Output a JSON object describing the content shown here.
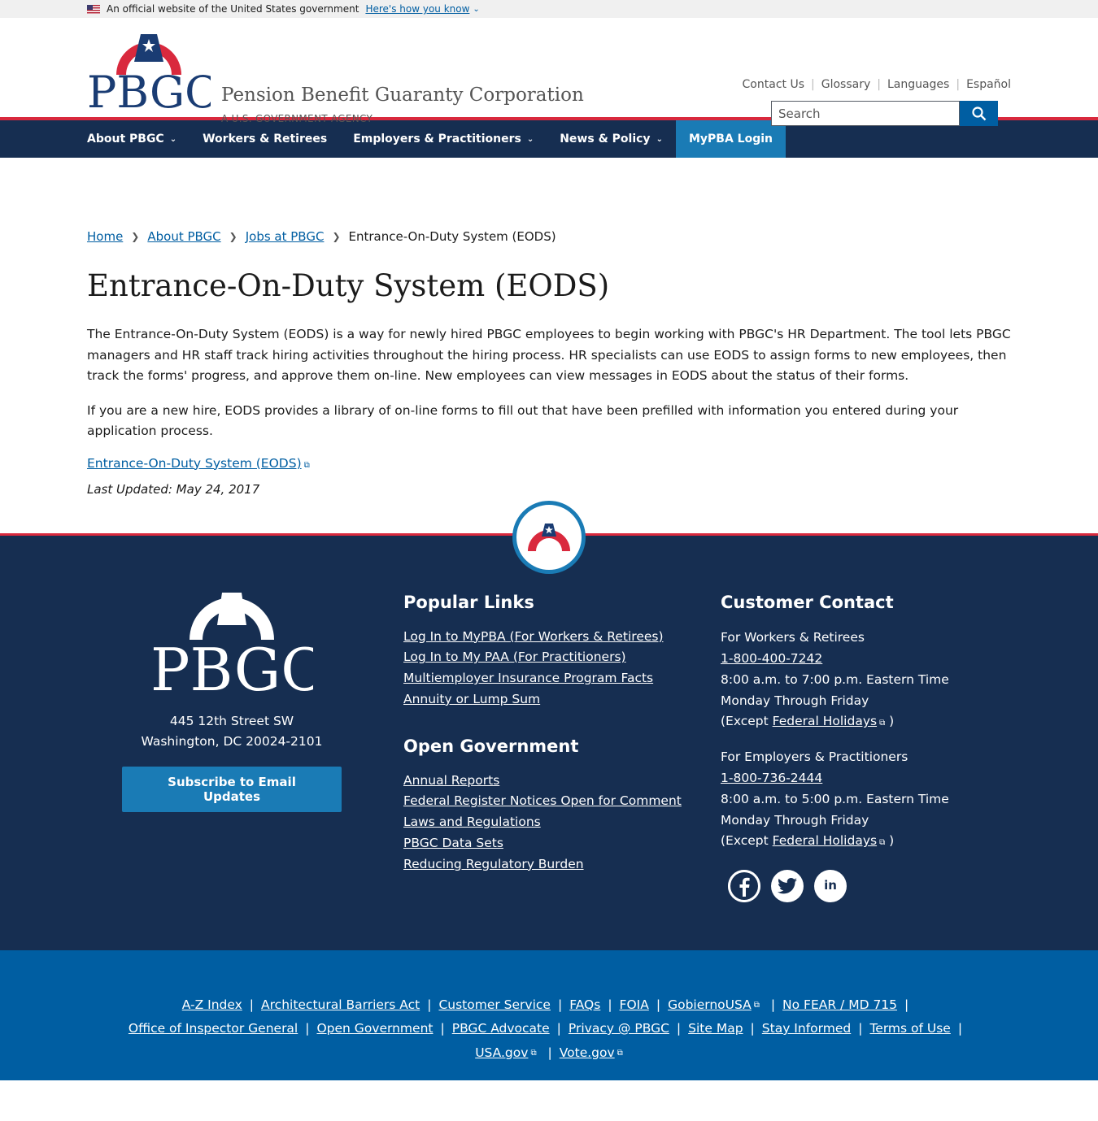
{
  "gov_banner": {
    "text": "An official website of the United States government",
    "link": "Here's how you know"
  },
  "header": {
    "logo_text": "PBGC",
    "agency_name": "Pension Benefit Guaranty Corporation",
    "agency_sub": "A U.S. GOVERNMENT AGENCY",
    "util_links": [
      "Contact Us",
      "Glossary",
      "Languages",
      "Español"
    ],
    "search_placeholder": "Search"
  },
  "nav": {
    "items": [
      "About PBGC",
      "Workers & Retirees",
      "Employers & Practitioners",
      "News & Policy"
    ],
    "login": "MyPBA Login"
  },
  "breadcrumb": [
    "Home",
    "About PBGC",
    "Jobs at PBGC",
    "Entrance-On-Duty System (EODS)"
  ],
  "page": {
    "title": "Entrance-On-Duty System (EODS)",
    "para1": "The Entrance-On-Duty System (EODS) is a way for newly hired PBGC employees to begin working with PBGC's HR Department. The tool lets PBGC managers and HR staff track hiring activities throughout the hiring process. HR specialists can use EODS to assign forms to new employees, then track the forms' progress, and approve them on-line. New employees can view messages in EODS about the status of their forms.",
    "para2": "If you are a new hire, EODS provides a library of on-line forms to fill out that have been prefilled with information you entered during your application process.",
    "link": "Entrance-On-Duty System (EODS)",
    "updated": "Last Updated: May 24, 2017"
  },
  "footer": {
    "logo_text": "PBGC",
    "address1": "445 12th Street SW",
    "address2": "Washington, DC 20024-2101",
    "subscribe": "Subscribe to Email Updates",
    "popular_title": "Popular Links",
    "popular_links": [
      "Log In to MyPBA (For Workers & Retirees)",
      "Log In to My PAA (For Practitioners)",
      "Multiemployer Insurance Program Facts",
      "Annuity or Lump Sum"
    ],
    "open_title": "Open Government",
    "open_links": [
      "Annual Reports",
      "Federal Register Notices Open for Comment",
      "Laws and Regulations",
      "PBGC Data Sets",
      "Reducing Regulatory Burden"
    ],
    "contact_title": "Customer Contact",
    "contact1": {
      "label": "For Workers & Retirees",
      "phone": "1-800-400-7242",
      "hours": "8:00 a.m. to 7:00 p.m. Eastern Time Monday Through Friday",
      "except": "(Except",
      "holidays": "Federal Holidays",
      "close": ")"
    },
    "contact2": {
      "label": "For Employers & Practitioners",
      "phone": "1-800-736-2444",
      "hours": "8:00 a.m. to 5:00 p.m. Eastern Time Monday Through Friday",
      "except": "(Except",
      "holidays": "Federal Holidays",
      "close": ")"
    },
    "bottom_row1": [
      "A-Z Index",
      "Architectural Barriers Act",
      "Customer Service",
      "FAQs",
      "FOIA",
      "GobiernoUSA",
      "No FEAR / MD 715"
    ],
    "bottom_row2": [
      "Office of Inspector General",
      "Open Government",
      "PBGC Advocate",
      "Privacy @ PBGC",
      "Site Map",
      "Stay Informed",
      "Terms of Use"
    ],
    "bottom_row3": [
      "USA.gov",
      "Vote.gov"
    ]
  },
  "colors": {
    "navy": "#162e51",
    "blue": "#005ea2",
    "accent_blue": "#1a7bb5",
    "red": "#d9293d"
  }
}
